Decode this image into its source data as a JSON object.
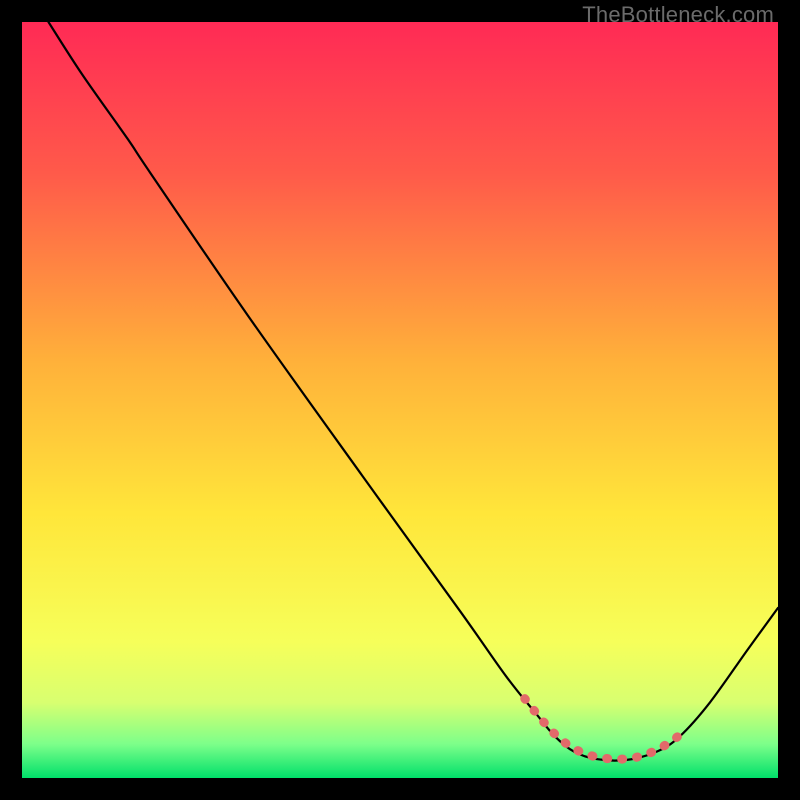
{
  "watermark": "TheBottleneck.com",
  "chart_data": {
    "type": "line",
    "title": "",
    "xlabel": "",
    "ylabel": "",
    "xlim": [
      0,
      100
    ],
    "ylim": [
      0,
      100
    ],
    "grid": false,
    "legend": false,
    "gradient_stops": [
      {
        "offset": 0.0,
        "color": "#ff2a55"
      },
      {
        "offset": 0.2,
        "color": "#ff5a4a"
      },
      {
        "offset": 0.45,
        "color": "#ffb13a"
      },
      {
        "offset": 0.65,
        "color": "#ffe63a"
      },
      {
        "offset": 0.82,
        "color": "#f6ff5a"
      },
      {
        "offset": 0.9,
        "color": "#d8ff70"
      },
      {
        "offset": 0.955,
        "color": "#7dff8a"
      },
      {
        "offset": 1.0,
        "color": "#00e06a"
      }
    ],
    "series": [
      {
        "name": "bottleneck-curve",
        "stroke": "#000000",
        "stroke_width": 2.2,
        "points": [
          {
            "x": 3.5,
            "y": 100.0
          },
          {
            "x": 8.0,
            "y": 93.0
          },
          {
            "x": 14.0,
            "y": 84.5
          },
          {
            "x": 17.0,
            "y": 80.0
          },
          {
            "x": 30.0,
            "y": 61.0
          },
          {
            "x": 45.0,
            "y": 40.0
          },
          {
            "x": 58.0,
            "y": 22.0
          },
          {
            "x": 64.0,
            "y": 13.5
          },
          {
            "x": 68.0,
            "y": 8.5
          },
          {
            "x": 70.5,
            "y": 5.5
          },
          {
            "x": 73.0,
            "y": 3.5
          },
          {
            "x": 76.0,
            "y": 2.5
          },
          {
            "x": 80.0,
            "y": 2.4
          },
          {
            "x": 84.0,
            "y": 3.5
          },
          {
            "x": 87.0,
            "y": 5.5
          },
          {
            "x": 91.0,
            "y": 10.0
          },
          {
            "x": 96.0,
            "y": 17.0
          },
          {
            "x": 100.0,
            "y": 22.5
          }
        ]
      },
      {
        "name": "sweet-spot-marker",
        "stroke": "#e26a6a",
        "stroke_width": 9,
        "linecap": "round",
        "dash": [
          1,
          14
        ],
        "points": [
          {
            "x": 66.5,
            "y": 10.5
          },
          {
            "x": 68.5,
            "y": 8.0
          },
          {
            "x": 70.5,
            "y": 5.8
          },
          {
            "x": 72.5,
            "y": 4.2
          },
          {
            "x": 74.5,
            "y": 3.2
          },
          {
            "x": 76.5,
            "y": 2.7
          },
          {
            "x": 78.5,
            "y": 2.5
          },
          {
            "x": 80.5,
            "y": 2.6
          },
          {
            "x": 82.5,
            "y": 3.1
          },
          {
            "x": 84.5,
            "y": 4.0
          },
          {
            "x": 86.5,
            "y": 5.3
          },
          {
            "x": 88.0,
            "y": 6.6
          }
        ]
      }
    ]
  }
}
